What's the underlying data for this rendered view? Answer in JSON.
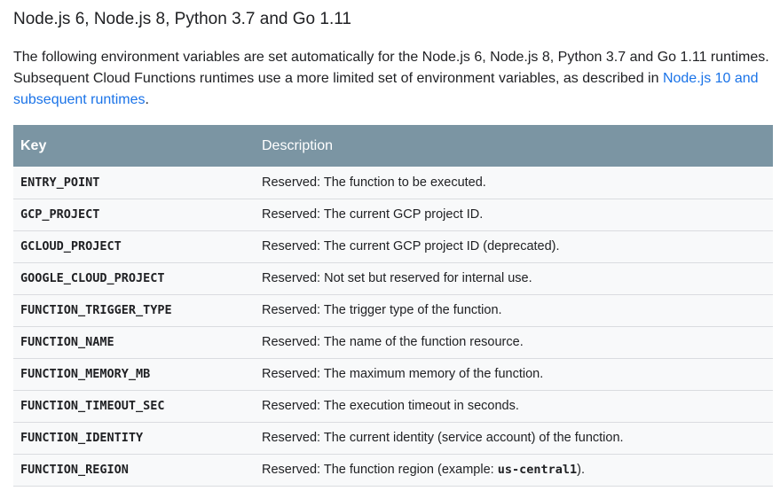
{
  "section_title": "Node.js 6, Node.js 8, Python 3.7 and Go 1.11",
  "intro": {
    "text_before_link": "The following environment variables are set automatically for the Node.js 6, Node.js 8, Python 3.7 and Go 1.11 runtimes. Subsequent Cloud Functions runtimes use a more limited set of environment variables, as described in ",
    "link_text": "Node.js 10 and subsequent runtimes",
    "text_after_link": ".",
    "link_color": "#1a73e8"
  },
  "table": {
    "header_color": "#7b95a3",
    "headers": {
      "key": "Key",
      "description": "Description"
    },
    "rows": [
      {
        "key": "ENTRY_POINT",
        "description": "Reserved: The function to be executed."
      },
      {
        "key": "GCP_PROJECT",
        "description": "Reserved: The current GCP project ID."
      },
      {
        "key": "GCLOUD_PROJECT",
        "description": "Reserved: The current GCP project ID (deprecated)."
      },
      {
        "key": "GOOGLE_CLOUD_PROJECT",
        "description": "Reserved: Not set but reserved for internal use."
      },
      {
        "key": "FUNCTION_TRIGGER_TYPE",
        "description": "Reserved: The trigger type of the function."
      },
      {
        "key": "FUNCTION_NAME",
        "description": "Reserved: The name of the function resource."
      },
      {
        "key": "FUNCTION_MEMORY_MB",
        "description": "Reserved: The maximum memory of the function."
      },
      {
        "key": "FUNCTION_TIMEOUT_SEC",
        "description": "Reserved: The execution timeout in seconds."
      },
      {
        "key": "FUNCTION_IDENTITY",
        "description": "Reserved: The current identity (service account) of the function."
      },
      {
        "key": "FUNCTION_REGION",
        "description": "Reserved: The function region (example: ",
        "code": "us-central1",
        "description_after_code": ")."
      }
    ]
  }
}
